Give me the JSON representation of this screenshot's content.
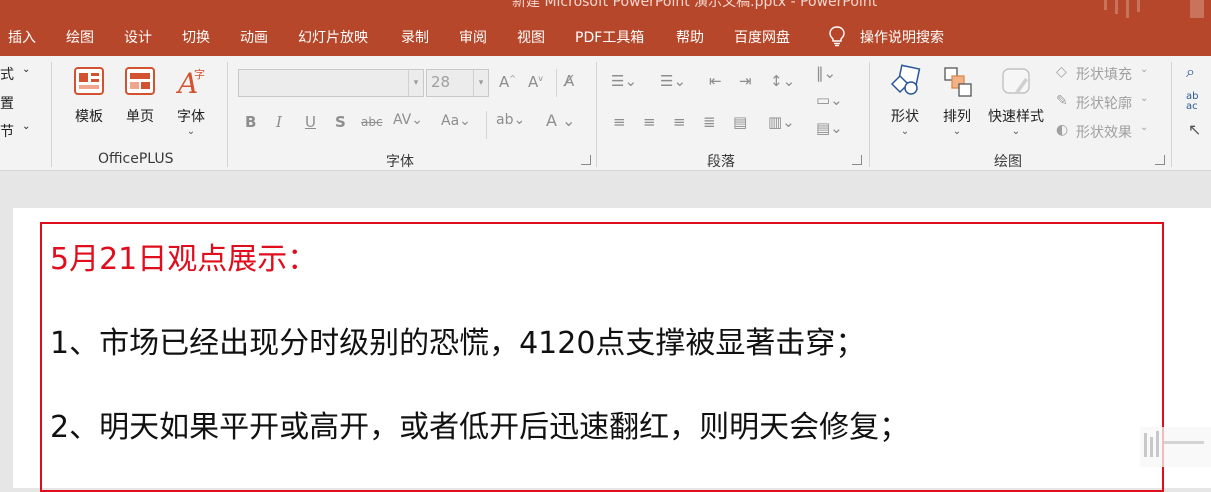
{
  "window": {
    "title": "新建 Microsoft PowerPoint 演示文稿.pptx  -  PowerPoint"
  },
  "menu": {
    "items": [
      "插入",
      "绘图",
      "设计",
      "切换",
      "动画",
      "幻灯片放映",
      "录制",
      "审阅",
      "视图",
      "PDF工具箱",
      "帮助",
      "百度网盘",
      "操作说明搜索"
    ]
  },
  "ribbon": {
    "cutoff_left": [
      "式",
      "置",
      "节"
    ],
    "officeplus": {
      "buttons": [
        "模板",
        "单页",
        "字体"
      ],
      "group_label": "OfficePLUS"
    },
    "font": {
      "font_name_value": "",
      "font_size_value": "28",
      "group_label": "字体"
    },
    "paragraph": {
      "group_label": "段落"
    },
    "drawing": {
      "shapes_label": "形状",
      "arrange_label": "排列",
      "quick_styles_label": "快速样式",
      "shape_fill_label": "形状填充",
      "shape_outline_label": "形状轮廓",
      "shape_effects_label": "形状效果",
      "group_label": "绘图"
    }
  },
  "slide": {
    "heading": "5月21日观点展示：",
    "line1": "1、市场已经出现分时级别的恐慌，4120点支撑被显著击穿；",
    "line2": "2、明天如果平开或高开，或者低开后迅速翻红，则明天会修复；",
    "colors": {
      "heading": "#e00d1c",
      "body": "#111111",
      "border": "#e00d1c"
    }
  },
  "theme": {
    "accent": "#b7472a",
    "ribbon_bg": "#f3f3f3",
    "canvas_bg": "#e6e6e6"
  }
}
